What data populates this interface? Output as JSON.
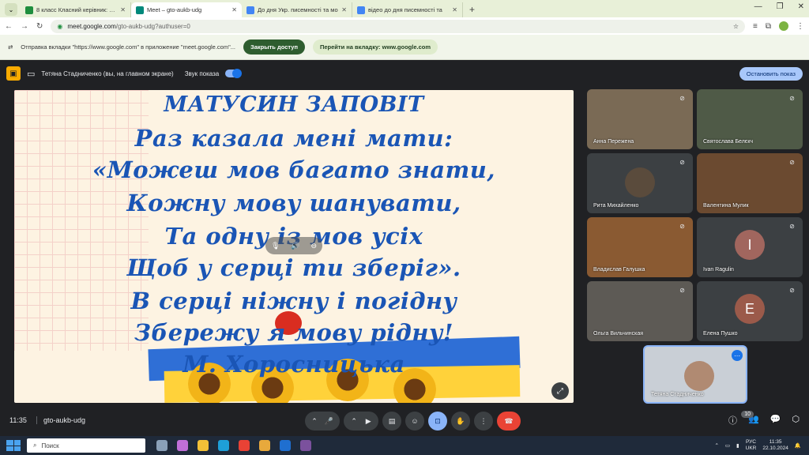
{
  "browser": {
    "tabs": [
      {
        "title": "8 класс Класний керівник: Стад",
        "color": "#1e8e3e",
        "active": false
      },
      {
        "title": "Meet – gto-aukb-udg",
        "color": "#00897b",
        "active": true
      },
      {
        "title": "До дня Укр. писемності та мо",
        "color": "#4285f4",
        "active": false
      },
      {
        "title": "відео до дня писемності та",
        "color": "#4285f4",
        "active": false
      }
    ],
    "url_domain": "meet.google.com",
    "url_path": "/gto-aukb-udg?authuser=0"
  },
  "infobar": {
    "message": "Отправка вкладки \"https://www.google.com\" в приложение \"meet.google.com\"...",
    "close_access": "Закрыть доступ",
    "go_to_tab": "Перейти на вкладку: www.google.com"
  },
  "presentation": {
    "presenter": "Тетяна Стадниченко (вы, на главном экране)",
    "sound_label": "Звук показа",
    "stop_label": "Остановить показ"
  },
  "slide": {
    "title": "МАТУСИН ЗАПОВІТ",
    "lines": [
      "Раз казала мені мати:",
      "«Можеш мов багато знати,",
      "Кожну мову шанувати,",
      "Та одну із мов усіх",
      "Щоб у серці ти зберіг».",
      "В серці ніжну і погідну",
      "Збережу я мову рідну!",
      "М. Хоросницька"
    ]
  },
  "participants": [
    {
      "name": "Анна Пережена",
      "avatar": "",
      "bg": "#7a6a55"
    },
    {
      "name": "Святослава Белєкч",
      "avatar": "",
      "bg": "#4f5a47"
    },
    {
      "name": "Рита Михайленко",
      "avatar": "",
      "bg": "#3c4043"
    },
    {
      "name": "Валентина Мулик",
      "avatar": "",
      "bg": "#6b4a30"
    },
    {
      "name": "Владислав Галушка",
      "avatar": "",
      "bg": "#8a5a32"
    },
    {
      "name": "Ivan Ragulin",
      "avatar": "I",
      "bg": "#3c4043",
      "avatar_color": "#a1665e"
    },
    {
      "name": "Ольга Вильчинская",
      "avatar": "",
      "bg": "#5d5a55"
    },
    {
      "name": "Елена Пушко",
      "avatar": "E",
      "bg": "#3c4043",
      "avatar_color": "#9b5a4a"
    }
  ],
  "self_tile": {
    "name": "Тетяна Стадниченко"
  },
  "meeting": {
    "time": "11:35",
    "code": "gto-aukb-udg",
    "participant_count": "10"
  },
  "taskbar": {
    "search_placeholder": "Поиск",
    "lang_top": "РУС",
    "lang_bottom": "UKR",
    "time": "11:35",
    "date": "22.10.2024"
  }
}
